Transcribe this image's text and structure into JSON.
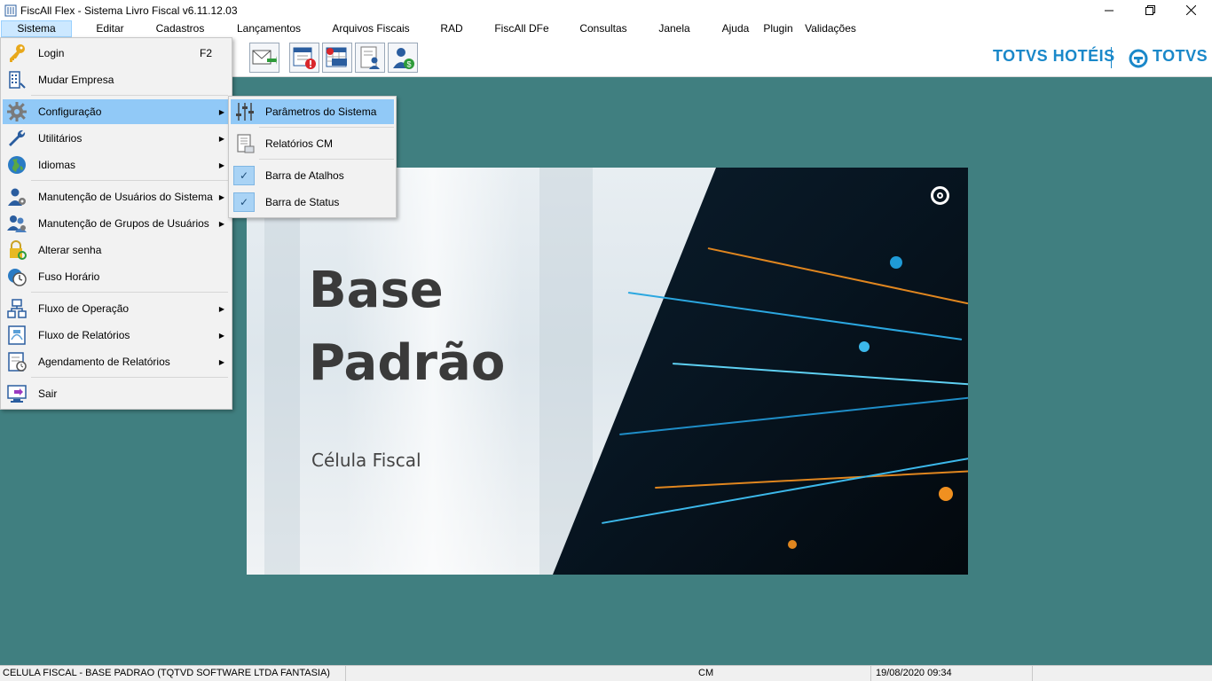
{
  "window": {
    "title": "FiscAll Flex - Sistema Livro Fiscal v6.11.12.03"
  },
  "menubar": {
    "items": [
      "Sistema",
      "Editar",
      "Cadastros",
      "Lançamentos",
      "Arquivos Fiscais",
      "RAD",
      "FiscAll DFe",
      "Consultas",
      "Janela",
      "Ajuda",
      "Plugin",
      "Validações"
    ],
    "active": "Sistema"
  },
  "brand": {
    "left": "TOTVS HOTÉIS",
    "right": "TOTVS"
  },
  "splash": {
    "title_line1": "Base",
    "title_line2": "Padrão",
    "subtitle": "Célula Fiscal"
  },
  "sistema_menu": {
    "items": [
      {
        "label": "Login",
        "shortcut": "F2",
        "icon": "key-icon"
      },
      {
        "label": "Mudar Empresa",
        "icon": "building-icon"
      },
      {
        "label": "Configuração",
        "icon": "gear-icon",
        "submenu": true,
        "highlighted": true
      },
      {
        "label": "Utilitários",
        "icon": "wrench-icon",
        "submenu": true
      },
      {
        "label": "Idiomas",
        "icon": "globe-icon",
        "submenu": true
      },
      {
        "label": "Manutenção de Usuários do Sistema",
        "icon": "user-gear-icon",
        "submenu": true
      },
      {
        "label": "Manutenção de Grupos de Usuários",
        "icon": "users-icon",
        "submenu": true
      },
      {
        "label": "Alterar senha",
        "icon": "lock-icon"
      },
      {
        "label": "Fuso Horário",
        "icon": "clock-icon"
      },
      {
        "label": "Fluxo de Operação",
        "icon": "flowchart-icon",
        "submenu": true
      },
      {
        "label": "Fluxo de Relatórios",
        "icon": "report-flow-icon",
        "submenu": true
      },
      {
        "label": "Agendamento de Relatórios",
        "icon": "schedule-icon",
        "submenu": true
      },
      {
        "label": "Sair",
        "icon": "exit-icon"
      }
    ]
  },
  "configuracao_submenu": {
    "items": [
      {
        "label": "Parâmetros do Sistema",
        "icon": "sliders-icon",
        "highlighted": true
      },
      {
        "label": "Relatórios CM",
        "icon": "report-icon"
      },
      {
        "label": "Barra de Atalhos",
        "checked": true
      },
      {
        "label": "Barra de Status",
        "checked": true
      }
    ]
  },
  "statusbar": {
    "company": "CELULA FISCAL - BASE PADRAO (TQTVD SOFTWARE LTDA FANTASIA)",
    "module": "CM",
    "datetime": "19/08/2020 09:34"
  },
  "colors": {
    "workspace": "#407f80",
    "menu_highlight": "#91c9f7",
    "brand": "#1a88c9"
  }
}
